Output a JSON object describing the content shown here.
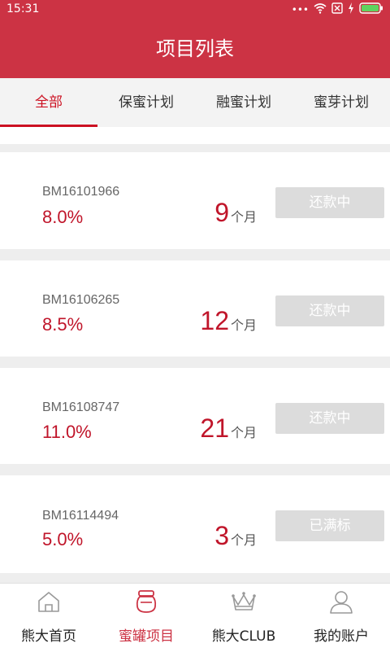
{
  "status_bar": {
    "time": "15:31"
  },
  "header": {
    "title": "项目列表"
  },
  "tabs": [
    {
      "label": "全部",
      "active": true
    },
    {
      "label": "保蜜计划",
      "active": false
    },
    {
      "label": "融蜜计划",
      "active": false
    },
    {
      "label": "蜜芽计划",
      "active": false
    }
  ],
  "projects": [
    {
      "id": "BM16101966",
      "rate": "8.0%",
      "term_value": "9",
      "term_unit": "个月",
      "status": "还款中"
    },
    {
      "id": "BM16106265",
      "rate": "8.5%",
      "term_value": "12",
      "term_unit": "个月",
      "status": "还款中"
    },
    {
      "id": "BM16108747",
      "rate": "11.0%",
      "term_value": "21",
      "term_unit": "个月",
      "status": "还款中"
    },
    {
      "id": "BM16114494",
      "rate": "5.0%",
      "term_value": "3",
      "term_unit": "个月",
      "status": "已满标"
    }
  ],
  "bottom_nav": [
    {
      "label": "熊大首页",
      "icon": "house-icon",
      "active": false
    },
    {
      "label": "蜜罐项目",
      "icon": "honey-jar-icon",
      "active": true
    },
    {
      "label": "熊大CLUB",
      "icon": "crown-icon",
      "active": false
    },
    {
      "label": "我的账户",
      "icon": "person-icon",
      "active": false
    }
  ],
  "colors": {
    "accent": "#cc3344",
    "rate_red": "#c0152a",
    "disabled_button": "#dcdcdc"
  }
}
